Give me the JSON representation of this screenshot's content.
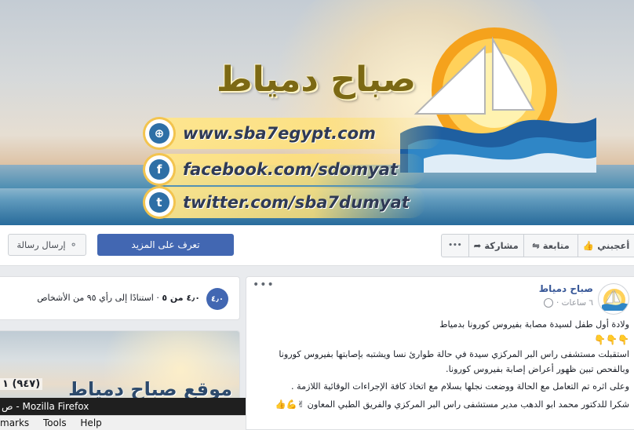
{
  "cover": {
    "wordmark": "صباح دمياط",
    "links": [
      {
        "icon": "globe-icon",
        "glyph": "⊕",
        "text": "www.sba7egypt.com"
      },
      {
        "icon": "facebook-icon",
        "glyph": "f",
        "text": "facebook.com/sdomyat"
      },
      {
        "icon": "twitter-icon",
        "glyph": "t",
        "text": "twitter.com/sba7dumyat"
      }
    ]
  },
  "actions": {
    "send_message": "إرسال رسالة",
    "learn_more": "تعرف على المزيد",
    "more_dots": "•••",
    "share": "مشاركة",
    "follow": "متابعة",
    "like": "أعجبني"
  },
  "rating": {
    "badge": "٤٫٠",
    "score": "٤٫٠ من ٥",
    "separator": "·",
    "basis": "استنادًا إلى رأي ٩٥ من الأشخاص"
  },
  "site_card": {
    "banner_text": "موقع صباح دمياط",
    "count": "(٩٤٧) ١"
  },
  "post": {
    "more_dots": "•••",
    "page_name": "صباح دمياط",
    "time": "٦ ساعات ·",
    "lines": [
      "ولادة أول طفل لسيدة مصابة بفيروس كورونا بدمياط",
      "👇👇👇",
      "استقبلت مستشفى راس البر المركزي سيدة في حالة طوارئ نسا ويشتبه بإصابتها بفيروس كورونا",
      "وبالفحص تبين ظهور أعراض إصابة بفيروس كورونا.",
      "وعلى اثره تم التعامل مع الحالة ووضعت نجلها بسلام مع اتخاذ كافة الإجراءات الوقائية اللازمة .",
      "شكرا للدكتور محمد ابو الدهب مدير مستشفى راس البر المركزي والفريق الطبي المعاون ✌💪👍"
    ]
  },
  "firefox": {
    "title": "ص - Mozilla Firefox",
    "menu": [
      "marks",
      "Tools",
      "Help"
    ]
  },
  "colors": {
    "primary": "#4267b2",
    "link": "#385898",
    "page_bg": "#e9ebee"
  }
}
